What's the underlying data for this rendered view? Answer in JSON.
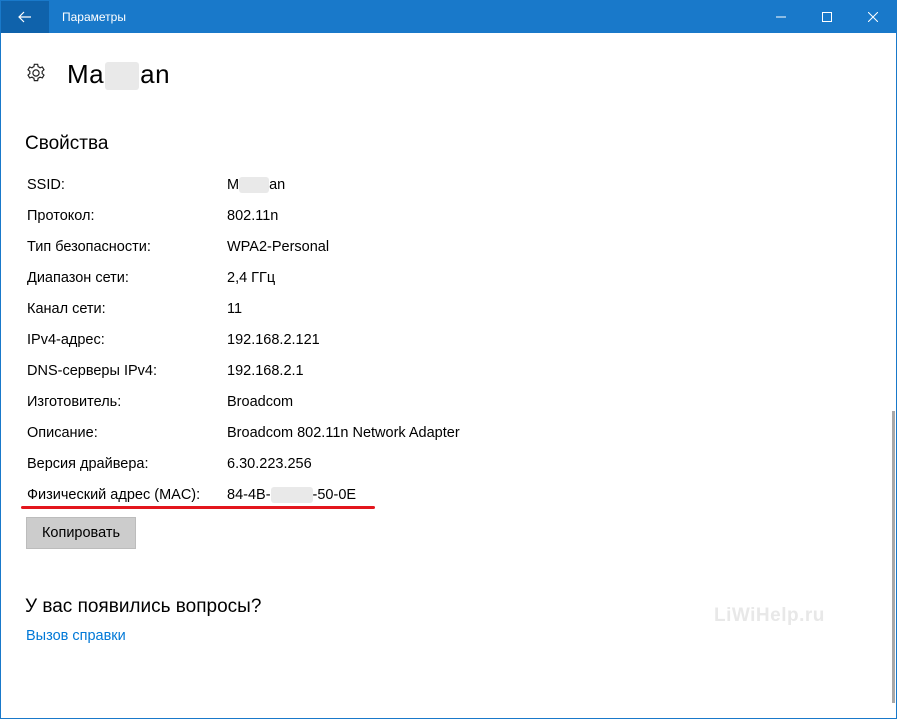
{
  "window": {
    "title": "Параметры",
    "accent_color": "#1979ca"
  },
  "header": {
    "network_name_start": "Ma",
    "network_name_end": "an"
  },
  "properties": {
    "section_title": "Свойства",
    "rows": [
      {
        "label": "SSID:",
        "value_start": "M",
        "value_end": "an",
        "redacted": true
      },
      {
        "label": "Протокол:",
        "value": "802.11n"
      },
      {
        "label": "Тип безопасности:",
        "value": "WPA2-Personal"
      },
      {
        "label": "Диапазон сети:",
        "value": "2,4 ГГц"
      },
      {
        "label": "Канал сети:",
        "value": "11"
      },
      {
        "label": "IPv4-адрес:",
        "value": "192.168.2.121"
      },
      {
        "label": "DNS-серверы IPv4:",
        "value": "192.168.2.1"
      },
      {
        "label": "Изготовитель:",
        "value": "Broadcom"
      },
      {
        "label": "Описание:",
        "value": "Broadcom 802.11n Network Adapter"
      },
      {
        "label": "Версия драйвера:",
        "value": "6.30.223.256"
      },
      {
        "label": "Физический адрес (MAC):",
        "value_start": "84-4B-",
        "value_end": "-50-0E",
        "redacted": true
      }
    ],
    "copy_button": "Копировать"
  },
  "help": {
    "title": "У вас появились вопросы?",
    "link": "Вызов справки"
  },
  "watermark": "LiWiHelp.ru"
}
